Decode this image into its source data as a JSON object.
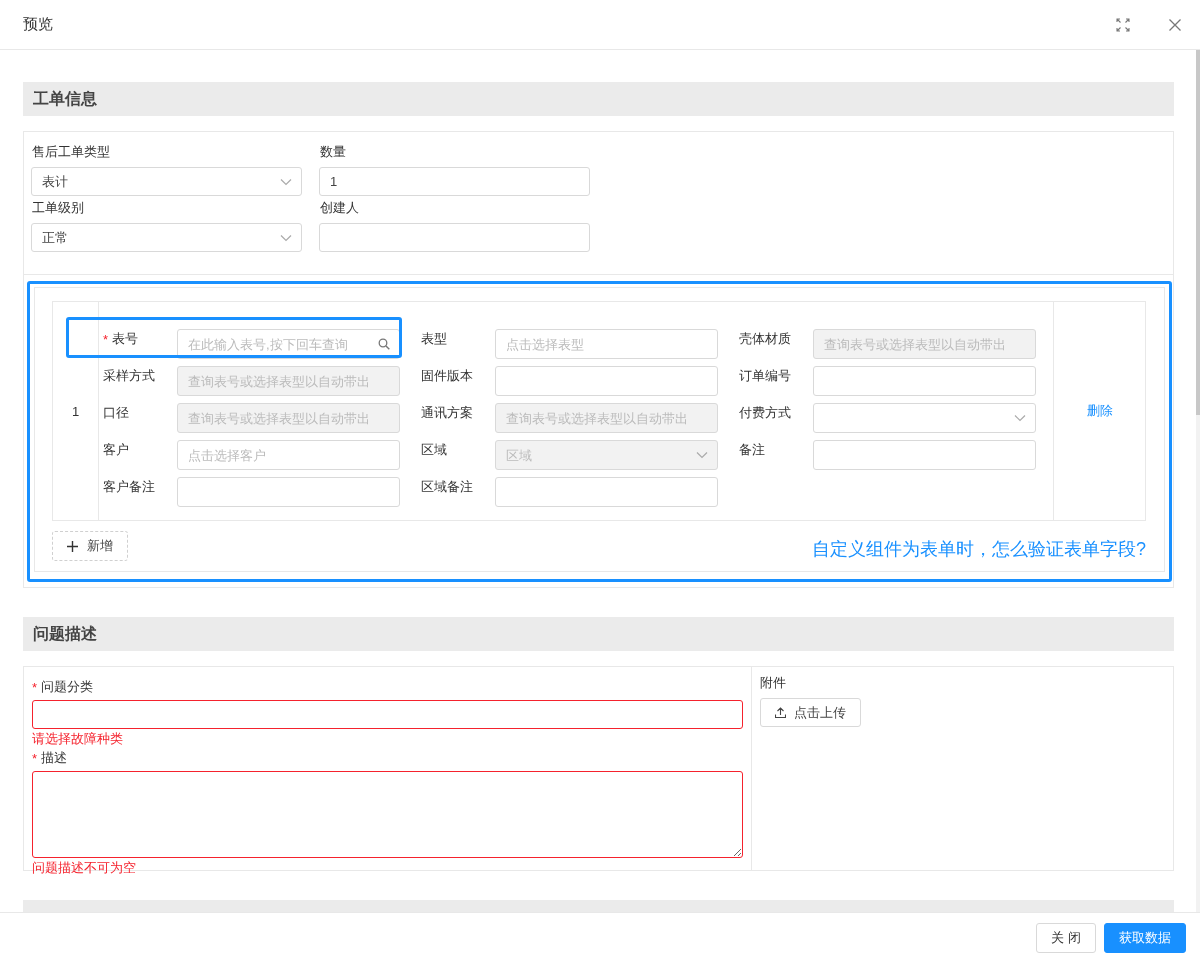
{
  "dialog": {
    "title": "预览"
  },
  "sections": [
    {
      "kind": "form",
      "title": "工单信息",
      "fields": [
        {
          "label": "售后工单类型",
          "kind": "select",
          "value": "表计"
        },
        {
          "label": "数量",
          "kind": "text",
          "value": "1"
        },
        {
          "label": "工单级别",
          "kind": "select",
          "value": "正常"
        },
        {
          "label": "创建人",
          "kind": "text"
        }
      ],
      "component": {
        "framed": true,
        "rows": [
          {
            "index": "1",
            "action": "删除",
            "fields": [
              {
                "label": "表号",
                "required": true,
                "required_mark": "*",
                "highlighted": true,
                "kind": "search",
                "placeholder": "在此输入表号,按下回车查询",
                "disabled": false
              },
              {
                "label": "表型",
                "required": false,
                "highlighted": false,
                "kind": "text",
                "placeholder": "点击选择表型",
                "disabled": false
              },
              {
                "label": "壳体材质",
                "required": false,
                "highlighted": false,
                "kind": "text",
                "placeholder": "查询表号或选择表型以自动带出",
                "disabled": true
              },
              {
                "label": "采样方式",
                "required": false,
                "highlighted": false,
                "kind": "text",
                "placeholder": "查询表号或选择表型以自动带出",
                "disabled": true
              },
              {
                "label": "固件版本",
                "required": false,
                "highlighted": false,
                "kind": "text",
                "disabled": false
              },
              {
                "label": "订单编号",
                "required": false,
                "highlighted": false,
                "kind": "text",
                "disabled": false
              },
              {
                "label": "口径",
                "required": false,
                "highlighted": false,
                "kind": "text",
                "placeholder": "查询表号或选择表型以自动带出",
                "disabled": true
              },
              {
                "label": "通讯方案",
                "required": false,
                "highlighted": false,
                "kind": "text",
                "placeholder": "查询表号或选择表型以自动带出",
                "disabled": true
              },
              {
                "label": "付费方式",
                "required": false,
                "highlighted": false,
                "kind": "select",
                "disabled": false
              },
              {
                "label": "客户",
                "required": false,
                "highlighted": false,
                "kind": "text",
                "placeholder": "点击选择客户",
                "disabled": false
              },
              {
                "label": "区域",
                "required": false,
                "highlighted": false,
                "kind": "select",
                "placeholder": "区域",
                "disabled": true
              },
              {
                "label": "备注",
                "required": false,
                "highlighted": false,
                "kind": "text",
                "disabled": false
              },
              {
                "label": "客户备注",
                "required": false,
                "highlighted": false,
                "kind": "text",
                "disabled": false
              },
              {
                "label": "区域备注",
                "required": false,
                "highlighted": false,
                "kind": "text",
                "disabled": false
              }
            ]
          }
        ],
        "add_button": "新增",
        "annotation": "自定义组件为表单时，怎么验证表单字段?"
      }
    },
    {
      "kind": "problem",
      "title": "问题描述",
      "items": [
        {
          "label": "问题分类",
          "required": true,
          "required_mark": "*",
          "kind": "input",
          "error": "请选择故障种类"
        },
        {
          "label": "描述",
          "required": true,
          "required_mark": "*",
          "kind": "textarea",
          "error": "问题描述不可为空"
        }
      ],
      "attachment": {
        "label": "附件",
        "button": "点击上传"
      }
    },
    {
      "kind": "cut_off"
    }
  ],
  "footer": {
    "buttons": [
      {
        "label": "关 闭",
        "primary": false
      },
      {
        "label": "获取数据",
        "primary": true
      }
    ]
  }
}
